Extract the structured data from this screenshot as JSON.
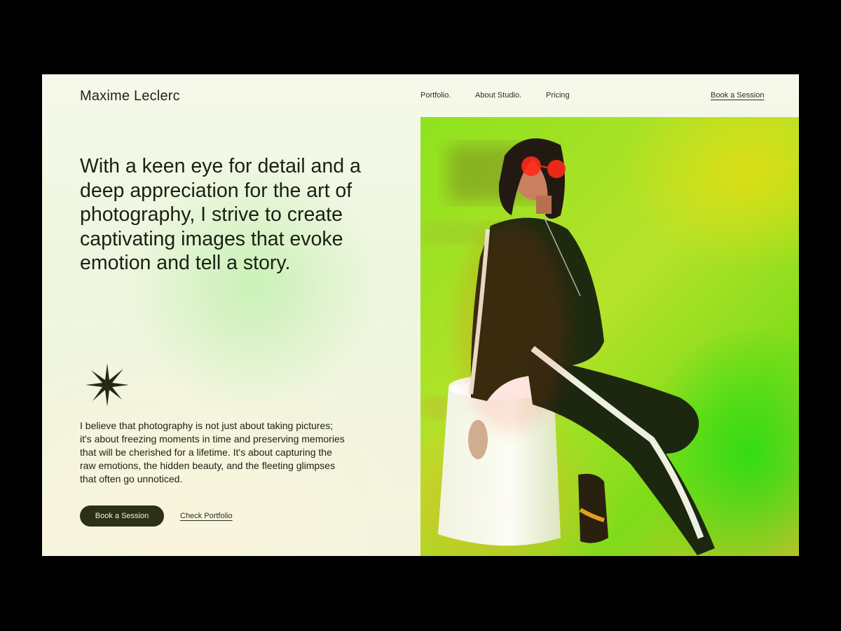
{
  "header": {
    "brand": "Maxime Leclerc",
    "nav": [
      "Portfolio.",
      "About Studio.",
      "Pricing"
    ],
    "cta": "Book a Session"
  },
  "hero": {
    "headline": "With a keen eye for detail and a deep appreciation for the art of photography, I strive to create captivating images that evoke emotion and tell a story.",
    "body": "I believe that photography is not just about taking pictures; it's about freezing moments in time and preserving memories that will be cherished for a lifetime. It's about capturing the raw emotions, the hidden beauty, and the fleeting glimpses that often go unnoticed.",
    "primary_button": "Book a Session",
    "secondary_link": "Check Portfolio"
  },
  "icons": {
    "decoration": "sparkle-star-icon"
  },
  "colors": {
    "page_background": "#f4f7e6",
    "text": "#1b2014",
    "button_background": "#2c3016",
    "button_text": "#f1f2e6",
    "photo_green": "#7fdc1a",
    "photo_yellow": "#dcde14"
  }
}
